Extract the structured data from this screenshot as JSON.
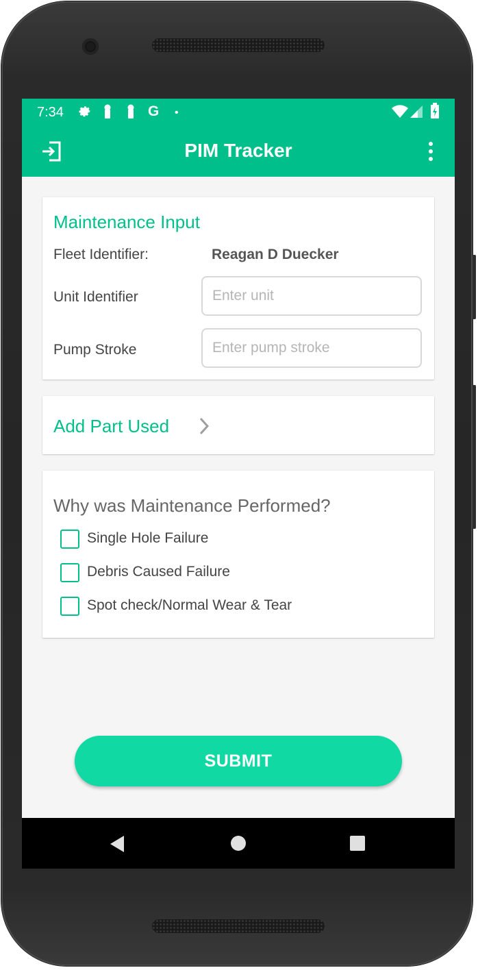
{
  "status_bar": {
    "time": "7:34",
    "left_icons": [
      "gear-icon",
      "key-icon",
      "key-icon",
      "google-g-icon",
      "dot-icon"
    ],
    "right_icons": [
      "wifi-icon",
      "cell-signal-icon",
      "battery-icon"
    ],
    "google_glyph": "G",
    "dot_glyph": "•"
  },
  "app_bar": {
    "title": "PIM Tracker",
    "left_icon": "logout-icon",
    "right_icon": "overflow-menu-icon"
  },
  "maintenance_card": {
    "title": "Maintenance Input",
    "fleet_label": "Fleet Identifier:",
    "fleet_value": "Reagan D Duecker",
    "unit_label": "Unit Identifier",
    "unit_value": "",
    "unit_placeholder": "Enter unit",
    "pump_label": "Pump Stroke",
    "pump_value": "",
    "pump_placeholder": "Enter pump stroke"
  },
  "parts_card": {
    "label": "Add Part Used",
    "icon": "chevron-right-icon"
  },
  "reason_card": {
    "title": "Why was Maintenance Performed?",
    "options": [
      {
        "label": "Single Hole Failure",
        "checked": false
      },
      {
        "label": "Debris Caused Failure",
        "checked": false
      },
      {
        "label": "Spot check/Normal Wear & Tear",
        "checked": false
      }
    ]
  },
  "submit_label": "SUBMIT",
  "nav_bar": {
    "icons": [
      "back-icon",
      "home-icon",
      "recents-icon"
    ]
  },
  "colors": {
    "primary": "#00bf8b",
    "button": "#10d9a3",
    "background": "#f5f5f5"
  }
}
